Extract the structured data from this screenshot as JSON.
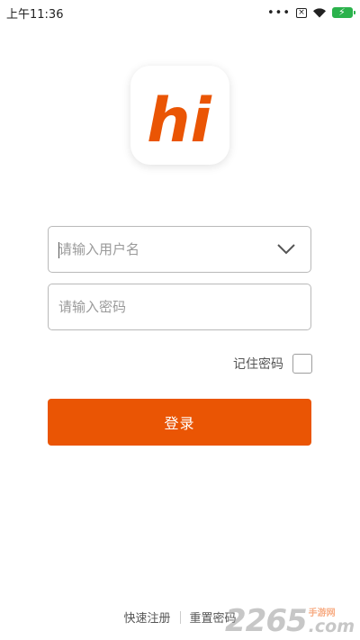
{
  "status_bar": {
    "time": "上午11:36",
    "icons": [
      "more-dots-icon",
      "sim-card-off-icon",
      "wifi-icon",
      "battery-charging-icon"
    ]
  },
  "logo": {
    "text": "hi",
    "color": "#ea5504"
  },
  "username_field": {
    "placeholder": "请输入用户名",
    "value": "",
    "dropdown_icon": "chevron-down-icon"
  },
  "password_field": {
    "placeholder": "请输入密码",
    "value": ""
  },
  "remember": {
    "label": "记住密码",
    "checked": false
  },
  "login_button": {
    "label": "登录",
    "color": "#ea5504"
  },
  "links": {
    "register": "快速注册",
    "reset": "重置密码"
  },
  "watermark": {
    "number": "2265",
    "cn": "手游网",
    "suffix": ".com"
  }
}
